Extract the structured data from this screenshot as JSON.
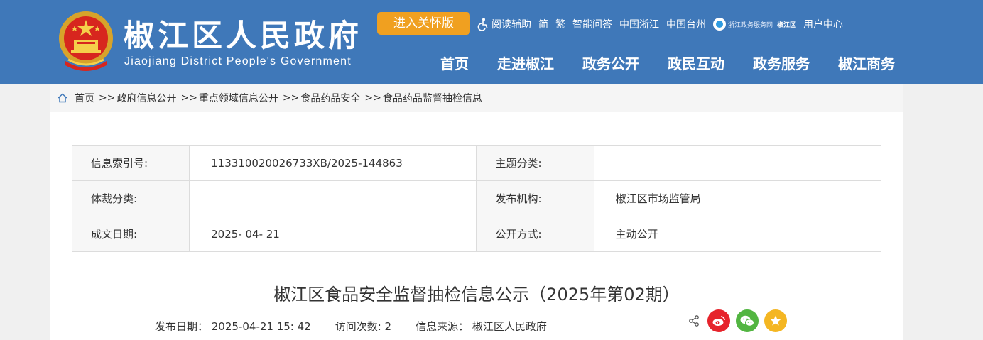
{
  "header": {
    "title": "椒江区人民政府",
    "subtitle": "Jiaojiang District People's Government",
    "care_button": "进入关怀版",
    "top_links": {
      "reading": "阅读辅助",
      "simplified": "简",
      "traditional": "繁",
      "qa": "智能问答",
      "zhejiang": "中国浙江",
      "taizhou": "中国台州",
      "service_badge": "浙江政务服务网",
      "jj_badge": "椒江区",
      "user_center": "用户中心"
    },
    "nav": [
      "首页",
      "走进椒江",
      "政务公开",
      "政民互动",
      "政务服务",
      "椒江商务"
    ]
  },
  "breadcrumb": [
    "首页",
    "政府信息公开",
    "重点领域信息公开",
    "食品药品安全",
    "食品药品监督抽检信息"
  ],
  "breadcrumb_sep": ">>",
  "info_table": [
    {
      "label1": "信息索引号:",
      "value1": "113310020026733XB/2025-144863",
      "label2": "主题分类:",
      "value2": ""
    },
    {
      "label1": "体裁分类:",
      "value1": "",
      "label2": "发布机构:",
      "value2": "椒江区市场监管局"
    },
    {
      "label1": "成文日期:",
      "value1": "2025- 04- 21",
      "label2": "公开方式:",
      "value2": "主动公开"
    }
  ],
  "document": {
    "title": "椒江区食品安全监督抽检信息公示（2025年第02期）",
    "publish_date": "发布日期：  2025-04-21 15: 42",
    "visits": "访问次数: 2",
    "source": "信息来源：  椒江区人民政府"
  },
  "colors": {
    "header_bg": "#3f78b9",
    "care_btn": "#f0a020",
    "weibo": "#e6232b",
    "wechat": "#52b541",
    "favorite": "#f4b622"
  }
}
